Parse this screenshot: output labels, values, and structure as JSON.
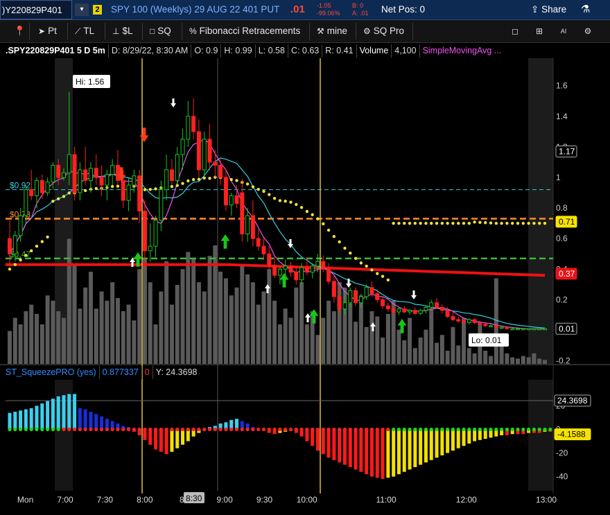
{
  "header": {
    "symbol": ")Y220829P401",
    "badge": "2",
    "description": "SPY 100 (Weeklys) 29 AUG 22 401 PUT",
    "last": ".01",
    "net_change": "-1.05",
    "pct_change": "-99.06%",
    "bid": "B: 0",
    "ask": "A: .01",
    "net_pos": "Net Pos: 0",
    "share_label": "Share"
  },
  "toolbar": {
    "items": [
      "Pt",
      "TL",
      "$L",
      "SQ",
      "Fibonacci Retracements",
      "mine",
      "SQ Pro"
    ]
  },
  "info_bar": {
    "symbol": ".SPY220829P401 5 D 5m",
    "date": "D: 8/29/22, 8:30 AM",
    "open": "O: 0.9",
    "high": "H: 0.99",
    "low": "L: 0.58",
    "close": "C: 0.63",
    "range": "R: 0.41",
    "volume_label": "Volume",
    "volume": "4,100",
    "study": "SimpleMovingAvg ..."
  },
  "study_bar": {
    "name": "ST_SqueezePRO (yes)",
    "value": "0.877337",
    "flag": "0",
    "y": "Y: 24.3698"
  },
  "colors": {
    "up_candle": "#18c818",
    "down_candle": "#ff2020",
    "sma_fast": "#ee55ee",
    "sma_slow": "#33d0e0",
    "dots": "#f2e040",
    "red_line": "#ee1111"
  },
  "chart_data": {
    "type": "candlestick",
    "price_axis": {
      "range": [
        -0.22,
        1.78
      ],
      "ticks": [
        "1.6",
        "1.4",
        "1.2",
        "1",
        "0.8",
        "0.6",
        "0.4",
        "0.2",
        "0",
        "-0.2"
      ]
    },
    "time_axis": {
      "ticks": [
        {
          "label": "Mon",
          "x": 0.067
        },
        {
          "label": "7:00",
          "x": 0.2
        },
        {
          "label": "7:30",
          "x": 0.333
        },
        {
          "label": "8:00",
          "x": 0.466
        },
        {
          "label": "8:30",
          "x": 0.6
        },
        {
          "label": "9:00",
          "x": 0.733
        },
        {
          "label": "9:30",
          "x": 0.866
        },
        {
          "label": "10:00",
          "x": 1.0
        },
        {
          "label": "11:00",
          "x": 1.266
        },
        {
          "label": "12:00",
          "x": 1.533
        },
        {
          "label": "13:00",
          "x": 1.8
        }
      ],
      "cursor_label": "8:30"
    },
    "price_labels": [
      {
        "text": "1.17",
        "value": 1.17,
        "style": "dark"
      },
      {
        "text": "0.71",
        "value": 0.71,
        "style": "yellow"
      },
      {
        "text": "0.37",
        "value": 0.37,
        "style": "red"
      },
      {
        "text": "0.01",
        "value": 0.01,
        "style": "dark"
      }
    ],
    "levels": [
      {
        "text": "$0.92",
        "value": 0.92,
        "color": "#33d0e0"
      },
      {
        "text": "$0.73",
        "value": 0.73,
        "color": "#ff8a2a"
      },
      {
        "text": "$0.47",
        "value": 0.47,
        "color": "#3ab83a"
      }
    ],
    "annotations": [
      {
        "text": "Hi: 1.56",
        "value": 1.56
      },
      {
        "text": "Lo: 0.01",
        "value": 0.01
      }
    ],
    "candles": [
      {
        "o": 0.6,
        "h": 0.72,
        "l": 0.42,
        "c": 0.5
      },
      {
        "o": 0.5,
        "h": 0.65,
        "l": 0.45,
        "c": 0.62
      },
      {
        "o": 0.62,
        "h": 0.8,
        "l": 0.58,
        "c": 0.75
      },
      {
        "o": 0.75,
        "h": 0.95,
        "l": 0.7,
        "c": 0.92
      },
      {
        "o": 0.92,
        "h": 1.05,
        "l": 0.85,
        "c": 0.88
      },
      {
        "o": 0.88,
        "h": 1.0,
        "l": 0.8,
        "c": 0.98
      },
      {
        "o": 0.98,
        "h": 1.02,
        "l": 0.86,
        "c": 0.9
      },
      {
        "o": 0.9,
        "h": 1.0,
        "l": 0.88,
        "c": 0.97
      },
      {
        "o": 0.97,
        "h": 1.1,
        "l": 0.92,
        "c": 1.08
      },
      {
        "o": 1.08,
        "h": 1.12,
        "l": 0.95,
        "c": 1.0
      },
      {
        "o": 1.0,
        "h": 1.06,
        "l": 0.98,
        "c": 1.03
      },
      {
        "o": 1.03,
        "h": 1.56,
        "l": 0.95,
        "c": 1.15
      },
      {
        "o": 1.15,
        "h": 1.2,
        "l": 0.85,
        "c": 0.9
      },
      {
        "o": 0.9,
        "h": 1.1,
        "l": 0.85,
        "c": 1.05
      },
      {
        "o": 1.05,
        "h": 1.2,
        "l": 0.95,
        "c": 0.98
      },
      {
        "o": 0.98,
        "h": 1.1,
        "l": 0.9,
        "c": 1.06
      },
      {
        "o": 1.06,
        "h": 1.15,
        "l": 0.95,
        "c": 1.0
      },
      {
        "o": 1.0,
        "h": 1.08,
        "l": 0.88,
        "c": 0.95
      },
      {
        "o": 0.95,
        "h": 1.05,
        "l": 0.85,
        "c": 1.02
      },
      {
        "o": 1.02,
        "h": 1.12,
        "l": 0.95,
        "c": 1.08
      },
      {
        "o": 1.08,
        "h": 1.18,
        "l": 0.95,
        "c": 0.98
      },
      {
        "o": 0.98,
        "h": 1.05,
        "l": 0.8,
        "c": 0.85
      },
      {
        "o": 0.85,
        "h": 1.0,
        "l": 0.78,
        "c": 0.95
      },
      {
        "o": 0.95,
        "h": 1.05,
        "l": 0.9,
        "c": 1.01
      },
      {
        "o": 1.01,
        "h": 1.05,
        "l": 0.7,
        "c": 0.78
      },
      {
        "o": 0.78,
        "h": 0.85,
        "l": 0.4,
        "c": 0.52
      },
      {
        "o": 0.52,
        "h": 0.7,
        "l": 0.45,
        "c": 0.55
      },
      {
        "o": 0.55,
        "h": 0.75,
        "l": 0.48,
        "c": 0.72
      },
      {
        "o": 0.72,
        "h": 0.98,
        "l": 0.65,
        "c": 0.92
      },
      {
        "o": 0.92,
        "h": 1.15,
        "l": 0.85,
        "c": 1.05
      },
      {
        "o": 1.05,
        "h": 1.12,
        "l": 0.95,
        "c": 0.98
      },
      {
        "o": 0.98,
        "h": 1.2,
        "l": 0.95,
        "c": 1.15
      },
      {
        "o": 1.15,
        "h": 1.32,
        "l": 1.05,
        "c": 1.25
      },
      {
        "o": 1.25,
        "h": 1.5,
        "l": 1.2,
        "c": 1.4
      },
      {
        "o": 1.4,
        "h": 1.52,
        "l": 1.25,
        "c": 1.3
      },
      {
        "o": 1.3,
        "h": 1.38,
        "l": 1.0,
        "c": 1.05
      },
      {
        "o": 1.05,
        "h": 1.3,
        "l": 1.0,
        "c": 1.25
      },
      {
        "o": 1.25,
        "h": 1.35,
        "l": 1.05,
        "c": 1.1
      },
      {
        "o": 1.1,
        "h": 1.18,
        "l": 1.0,
        "c": 1.08
      },
      {
        "o": 1.08,
        "h": 1.12,
        "l": 0.95,
        "c": 1.0
      },
      {
        "o": 1.0,
        "h": 1.05,
        "l": 0.78,
        "c": 0.82
      },
      {
        "o": 0.82,
        "h": 0.9,
        "l": 0.75,
        "c": 0.88
      },
      {
        "o": 0.88,
        "h": 0.95,
        "l": 0.8,
        "c": 0.83
      },
      {
        "o": 0.9,
        "h": 0.99,
        "l": 0.58,
        "c": 0.63
      },
      {
        "o": 0.63,
        "h": 0.8,
        "l": 0.58,
        "c": 0.75
      },
      {
        "o": 0.75,
        "h": 0.85,
        "l": 0.55,
        "c": 0.6
      },
      {
        "o": 0.6,
        "h": 0.66,
        "l": 0.52,
        "c": 0.55
      },
      {
        "o": 0.55,
        "h": 0.6,
        "l": 0.46,
        "c": 0.5
      },
      {
        "o": 0.5,
        "h": 0.55,
        "l": 0.4,
        "c": 0.42
      },
      {
        "o": 0.42,
        "h": 0.48,
        "l": 0.34,
        "c": 0.36
      },
      {
        "o": 0.36,
        "h": 0.42,
        "l": 0.3,
        "c": 0.4
      },
      {
        "o": 0.4,
        "h": 0.46,
        "l": 0.36,
        "c": 0.42
      },
      {
        "o": 0.42,
        "h": 0.45,
        "l": 0.35,
        "c": 0.38
      },
      {
        "o": 0.38,
        "h": 0.42,
        "l": 0.3,
        "c": 0.33
      },
      {
        "o": 0.33,
        "h": 0.44,
        "l": 0.3,
        "c": 0.41
      },
      {
        "o": 0.41,
        "h": 0.48,
        "l": 0.36,
        "c": 0.38
      },
      {
        "o": 0.38,
        "h": 0.44,
        "l": 0.34,
        "c": 0.42
      },
      {
        "o": 0.42,
        "h": 0.5,
        "l": 0.38,
        "c": 0.45
      },
      {
        "o": 0.45,
        "h": 0.49,
        "l": 0.38,
        "c": 0.4
      },
      {
        "o": 0.4,
        "h": 0.44,
        "l": 0.3,
        "c": 0.32
      },
      {
        "o": 0.32,
        "h": 0.36,
        "l": 0.18,
        "c": 0.22
      },
      {
        "o": 0.22,
        "h": 0.28,
        "l": 0.1,
        "c": 0.14
      },
      {
        "o": 0.14,
        "h": 0.24,
        "l": 0.1,
        "c": 0.18
      },
      {
        "o": 0.18,
        "h": 0.28,
        "l": 0.15,
        "c": 0.26
      },
      {
        "o": 0.26,
        "h": 0.28,
        "l": 0.16,
        "c": 0.18
      },
      {
        "o": 0.18,
        "h": 0.24,
        "l": 0.15,
        "c": 0.22
      },
      {
        "o": 0.22,
        "h": 0.3,
        "l": 0.2,
        "c": 0.28
      },
      {
        "o": 0.28,
        "h": 0.32,
        "l": 0.22,
        "c": 0.24
      },
      {
        "o": 0.24,
        "h": 0.27,
        "l": 0.18,
        "c": 0.2
      },
      {
        "o": 0.2,
        "h": 0.22,
        "l": 0.14,
        "c": 0.16
      },
      {
        "o": 0.16,
        "h": 0.18,
        "l": 0.12,
        "c": 0.14
      },
      {
        "o": 0.14,
        "h": 0.16,
        "l": 0.1,
        "c": 0.12
      },
      {
        "o": 0.12,
        "h": 0.15,
        "l": 0.1,
        "c": 0.14
      },
      {
        "o": 0.14,
        "h": 0.16,
        "l": 0.11,
        "c": 0.12
      },
      {
        "o": 0.12,
        "h": 0.14,
        "l": 0.1,
        "c": 0.13
      },
      {
        "o": 0.13,
        "h": 0.15,
        "l": 0.1,
        "c": 0.11
      },
      {
        "o": 0.11,
        "h": 0.14,
        "l": 0.1,
        "c": 0.13
      },
      {
        "o": 0.13,
        "h": 0.16,
        "l": 0.11,
        "c": 0.15
      },
      {
        "o": 0.15,
        "h": 0.2,
        "l": 0.13,
        "c": 0.18
      },
      {
        "o": 0.18,
        "h": 0.21,
        "l": 0.14,
        "c": 0.15
      },
      {
        "o": 0.15,
        "h": 0.17,
        "l": 0.11,
        "c": 0.13
      },
      {
        "o": 0.13,
        "h": 0.15,
        "l": 0.08,
        "c": 0.09
      },
      {
        "o": 0.09,
        "h": 0.12,
        "l": 0.06,
        "c": 0.07
      },
      {
        "o": 0.07,
        "h": 0.09,
        "l": 0.05,
        "c": 0.06
      },
      {
        "o": 0.06,
        "h": 0.08,
        "l": 0.04,
        "c": 0.05
      },
      {
        "o": 0.05,
        "h": 0.08,
        "l": 0.04,
        "c": 0.07
      },
      {
        "o": 0.07,
        "h": 0.08,
        "l": 0.04,
        "c": 0.05
      },
      {
        "o": 0.05,
        "h": 0.06,
        "l": 0.03,
        "c": 0.04
      },
      {
        "o": 0.04,
        "h": 0.05,
        "l": 0.02,
        "c": 0.03
      },
      {
        "o": 0.03,
        "h": 0.04,
        "l": 0.02,
        "c": 0.03
      },
      {
        "o": 0.03,
        "h": 0.04,
        "l": 0.01,
        "c": 0.02
      },
      {
        "o": 0.02,
        "h": 0.03,
        "l": 0.01,
        "c": 0.02
      },
      {
        "o": 0.02,
        "h": 0.02,
        "l": 0.01,
        "c": 0.01
      },
      {
        "o": 0.01,
        "h": 0.02,
        "l": 0.01,
        "c": 0.01
      },
      {
        "o": 0.01,
        "h": 0.02,
        "l": 0.01,
        "c": 0.01
      },
      {
        "o": 0.01,
        "h": 0.01,
        "l": 0.01,
        "c": 0.01
      },
      {
        "o": 0.01,
        "h": 0.01,
        "l": 0.01,
        "c": 0.01
      },
      {
        "o": 0.01,
        "h": 0.01,
        "l": 0.01,
        "c": 0.01
      },
      {
        "o": 0.01,
        "h": 0.01,
        "l": 0.01,
        "c": 0.01
      },
      {
        "o": 0.01,
        "h": 0.01,
        "l": 0.01,
        "c": 0.01
      }
    ],
    "volume_levels": [
      0.25,
      0.35,
      0.3,
      0.4,
      0.45,
      0.38,
      0.3,
      0.52,
      0.48,
      0.4,
      0.35,
      0.95,
      0.75,
      0.42,
      0.58,
      0.7,
      0.42,
      0.55,
      0.48,
      0.62,
      0.5,
      0.4,
      0.45,
      0.33,
      0.72,
      0.8,
      0.62,
      0.3,
      0.55,
      0.78,
      0.45,
      0.6,
      0.72,
      0.85,
      0.8,
      0.62,
      0.55,
      0.82,
      0.9,
      0.7,
      0.65,
      0.52,
      0.58,
      0.75,
      0.68,
      0.62,
      0.45,
      0.55,
      0.72,
      0.48,
      0.3,
      0.42,
      0.35,
      0.58,
      0.62,
      0.3,
      0.4,
      0.22,
      0.35,
      0.48,
      0.4,
      0.62,
      0.58,
      0.46,
      0.32,
      0.52,
      0.28,
      0.4,
      0.36,
      0.2,
      0.38,
      0.48,
      0.26,
      0.18,
      0.35,
      0.12,
      0.2,
      0.26,
      0.42,
      0.16,
      0.22,
      0.1,
      0.28,
      0.14,
      0.35,
      0.12,
      0.08,
      0.3,
      0.1,
      0.06,
      0.65,
      0.14,
      0.08,
      0.05,
      0.04,
      0.06,
      0.05,
      0.08,
      0.04,
      0.03,
      0.05
    ],
    "squeeze_axis": {
      "range": [
        -52,
        42
      ],
      "ticks": [
        "20",
        "0",
        "-20",
        "-40"
      ],
      "value_labels": [
        {
          "text": "24.3698",
          "value": 24.3698,
          "style": "dark"
        },
        {
          "text": "-4.1588",
          "value": -4.1588,
          "style": "yellow"
        }
      ]
    },
    "squeeze_histogram": [
      14,
      15,
      16,
      17,
      18,
      20,
      22,
      24,
      26,
      28,
      29,
      30,
      30,
      18,
      17,
      15,
      13,
      11,
      9,
      7,
      5,
      3,
      2,
      -2,
      -5,
      -9,
      -13,
      -17,
      -19,
      -21,
      -19,
      -16,
      -13,
      -10,
      -6,
      -3,
      -1,
      2,
      3,
      5,
      6,
      8,
      9,
      7,
      5,
      2,
      1,
      -1,
      -3,
      -4,
      -3,
      -2,
      -1,
      -3,
      -6,
      -10,
      -14,
      -18,
      -21,
      -24,
      -26,
      -28,
      -30,
      -32,
      -34,
      -36,
      -38,
      -40,
      -41,
      -42,
      -41,
      -40,
      -38,
      -36,
      -34,
      -32,
      -30,
      -28,
      -26,
      -24,
      -22,
      -20,
      -18,
      -16,
      -14,
      -12,
      -10,
      -9,
      -8,
      -7,
      -6,
      -5,
      -5,
      -4,
      -4,
      -4,
      -3,
      -3,
      -3,
      -2,
      -2
    ],
    "x_labels": [
      "Mon",
      "7:00",
      "7:30",
      "8:00",
      "8:30",
      "9:00",
      "9:30",
      "10:00",
      "11:00",
      "12:00",
      "13:00"
    ]
  }
}
